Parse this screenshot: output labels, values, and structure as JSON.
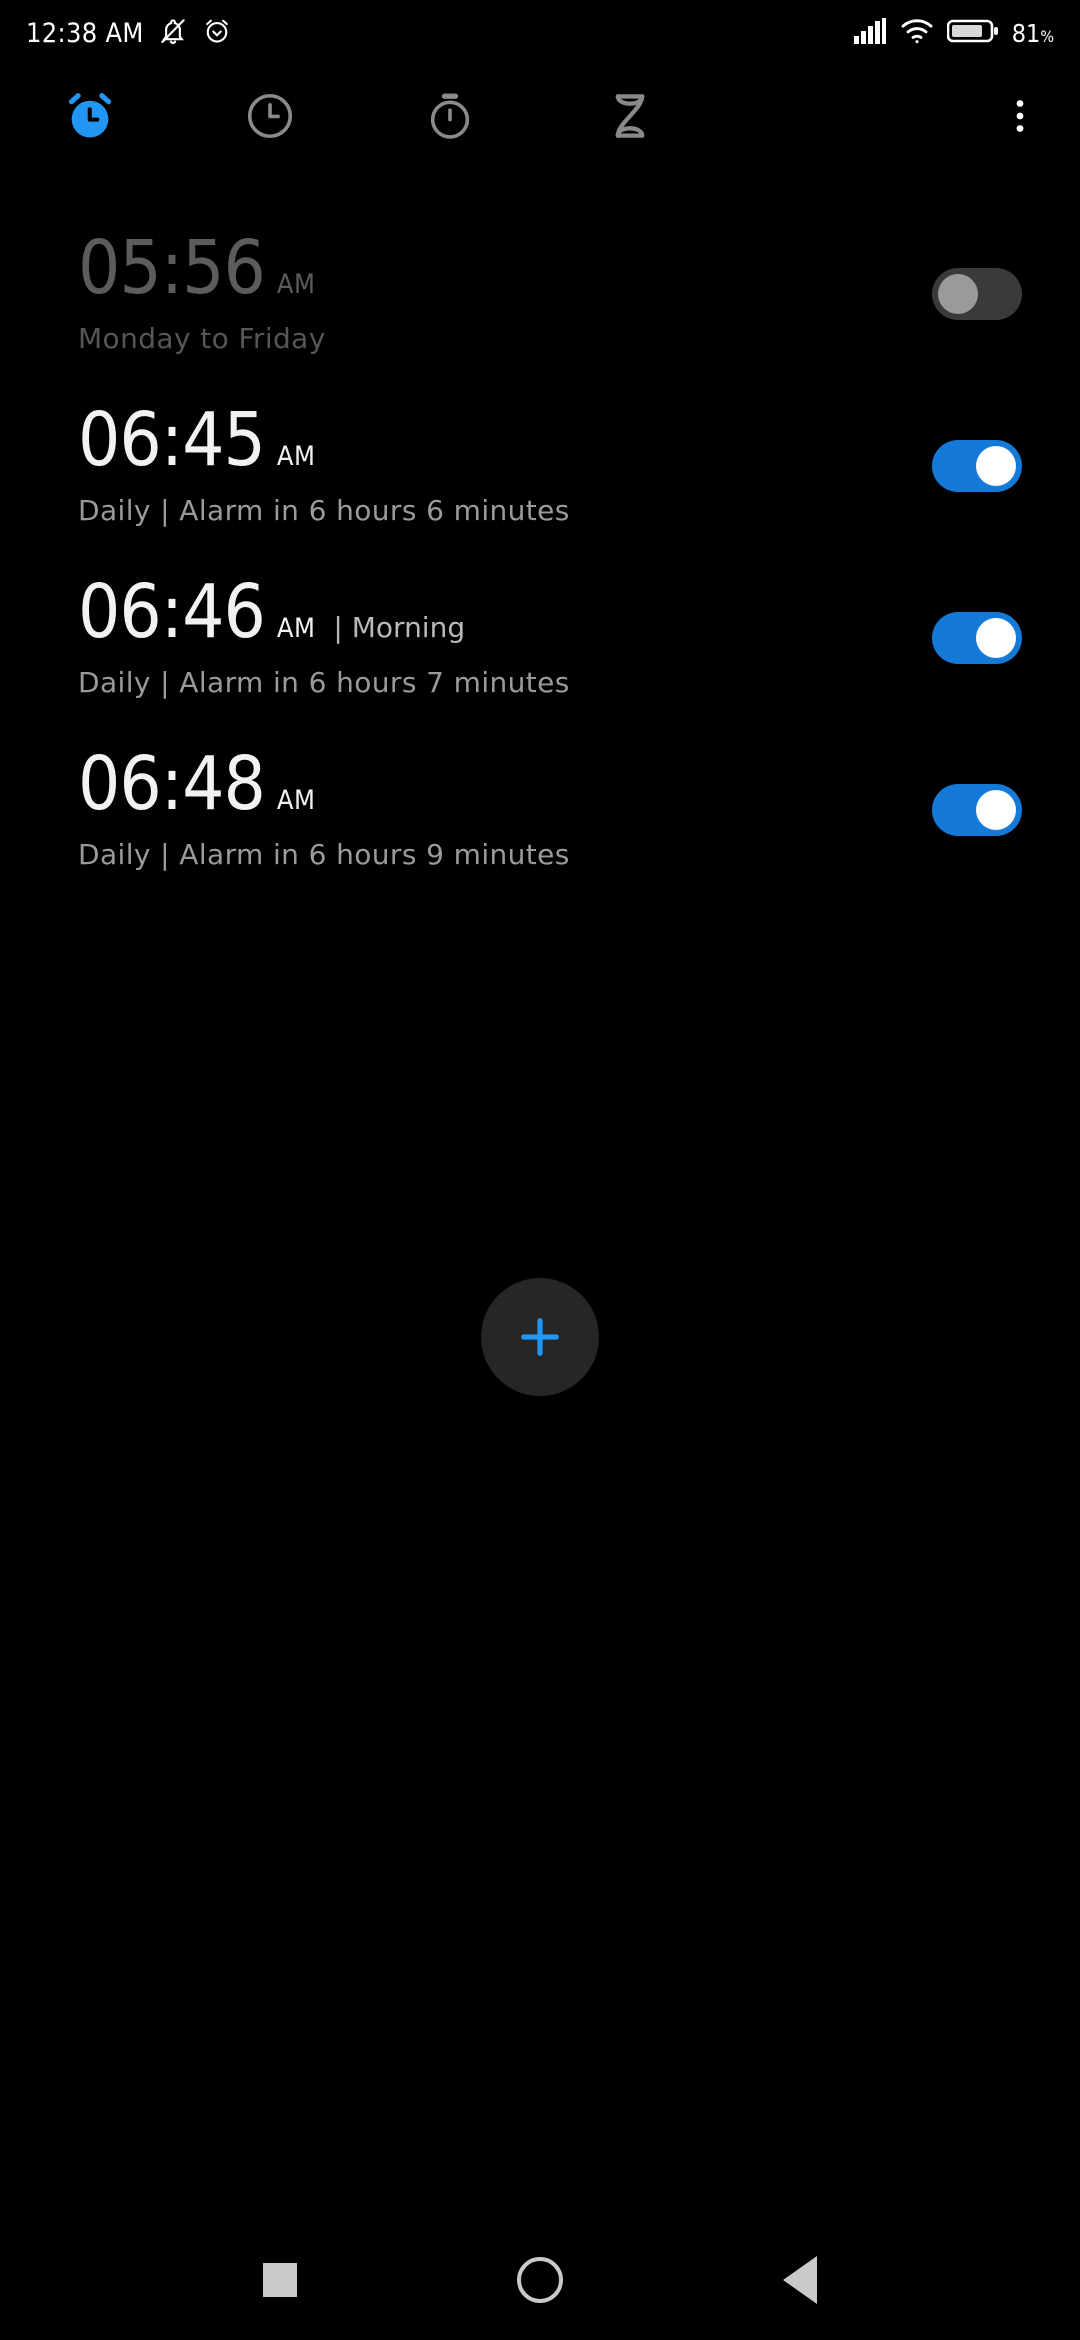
{
  "status_bar": {
    "time": "12:38 AM",
    "battery_percent": "81",
    "percent_symbol": "%",
    "icons": [
      "bell-muted-icon",
      "alarm-set-icon",
      "signal-bars-icon",
      "wifi-icon",
      "battery-icon"
    ]
  },
  "tabs": [
    {
      "name": "alarm",
      "icon": "alarm-clock-icon",
      "active": true
    },
    {
      "name": "clock",
      "icon": "clock-icon",
      "active": false
    },
    {
      "name": "stopwatch",
      "icon": "stopwatch-icon",
      "active": false
    },
    {
      "name": "timer",
      "icon": "hourglass-icon",
      "active": false
    },
    {
      "name": "overflow",
      "icon": "more-vertical-icon",
      "active": false
    }
  ],
  "alarms": [
    {
      "time": "05:56",
      "ampm": "AM",
      "label": "",
      "subtitle": "Monday to Friday",
      "enabled": false
    },
    {
      "time": "06:45",
      "ampm": "AM",
      "label": "",
      "subtitle": "Daily | Alarm in 6 hours 6 minutes",
      "enabled": true
    },
    {
      "time": "06:46",
      "ampm": "AM",
      "label": "| Morning",
      "subtitle": "Daily | Alarm in 6 hours 7 minutes",
      "enabled": true
    },
    {
      "time": "06:48",
      "ampm": "AM",
      "label": "",
      "subtitle": "Daily | Alarm in 6 hours 9 minutes",
      "enabled": true
    }
  ],
  "fab": {
    "icon": "plus-icon"
  },
  "nav_bar": {
    "recents": "recents-square-icon",
    "home": "home-circle-icon",
    "back": "back-triangle-icon"
  },
  "colors": {
    "accent_blue": "#2196f3",
    "toggle_on": "#1579d8",
    "toggle_off": "#3a3a3a",
    "background": "#000000",
    "inactive_icon": "#8a8a8a"
  }
}
